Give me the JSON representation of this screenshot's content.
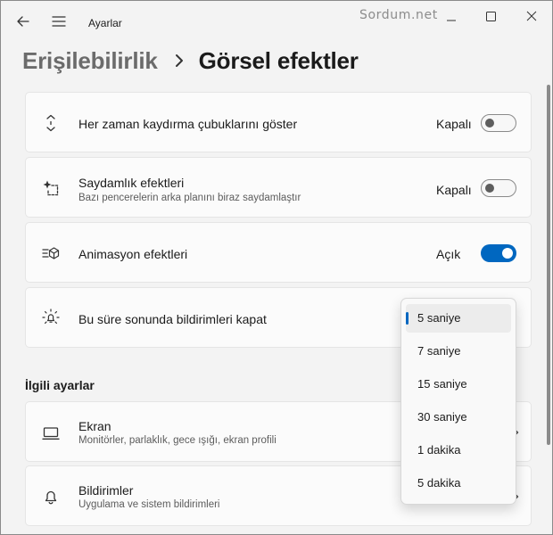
{
  "window": {
    "title": "Ayarlar",
    "watermark": "Sordum.net"
  },
  "breadcrumb": {
    "parent": "Erişilebilirlik",
    "current": "Görsel efektler"
  },
  "settings": [
    {
      "title": "Her zaman kaydırma çubuklarını göster",
      "description": "",
      "state_label": "Kapalı",
      "toggle_on": false,
      "icon": "scroll-arrows-icon"
    },
    {
      "title": "Saydamlık efektleri",
      "description": "Bazı pencerelerin arka planını biraz saydamlaştır",
      "state_label": "Kapalı",
      "toggle_on": false,
      "icon": "sparkle-transparency-icon"
    },
    {
      "title": "Animasyon efektleri",
      "description": "",
      "state_label": "Açık",
      "toggle_on": true,
      "icon": "animation-icon"
    },
    {
      "title": "Bu süre sonunda bildirimleri kapat",
      "description": "",
      "icon": "notification-timer-icon"
    }
  ],
  "dropdown": {
    "options": [
      "5 saniye",
      "7 saniye",
      "15 saniye",
      "30 saniye",
      "1 dakika",
      "5 dakika"
    ],
    "selected": "5 saniye"
  },
  "related": {
    "title": "İlgili ayarlar",
    "items": [
      {
        "title": "Ekran",
        "description": "Monitörler, parlaklık, gece ışığı, ekran profili",
        "icon": "monitor-icon"
      },
      {
        "title": "Bildirimler",
        "description": "Uygulama ve sistem bildirimleri",
        "icon": "bell-icon"
      }
    ]
  },
  "colors": {
    "accent": "#0067c0",
    "background": "#f3f3f3",
    "card": "#fbfbfb"
  }
}
